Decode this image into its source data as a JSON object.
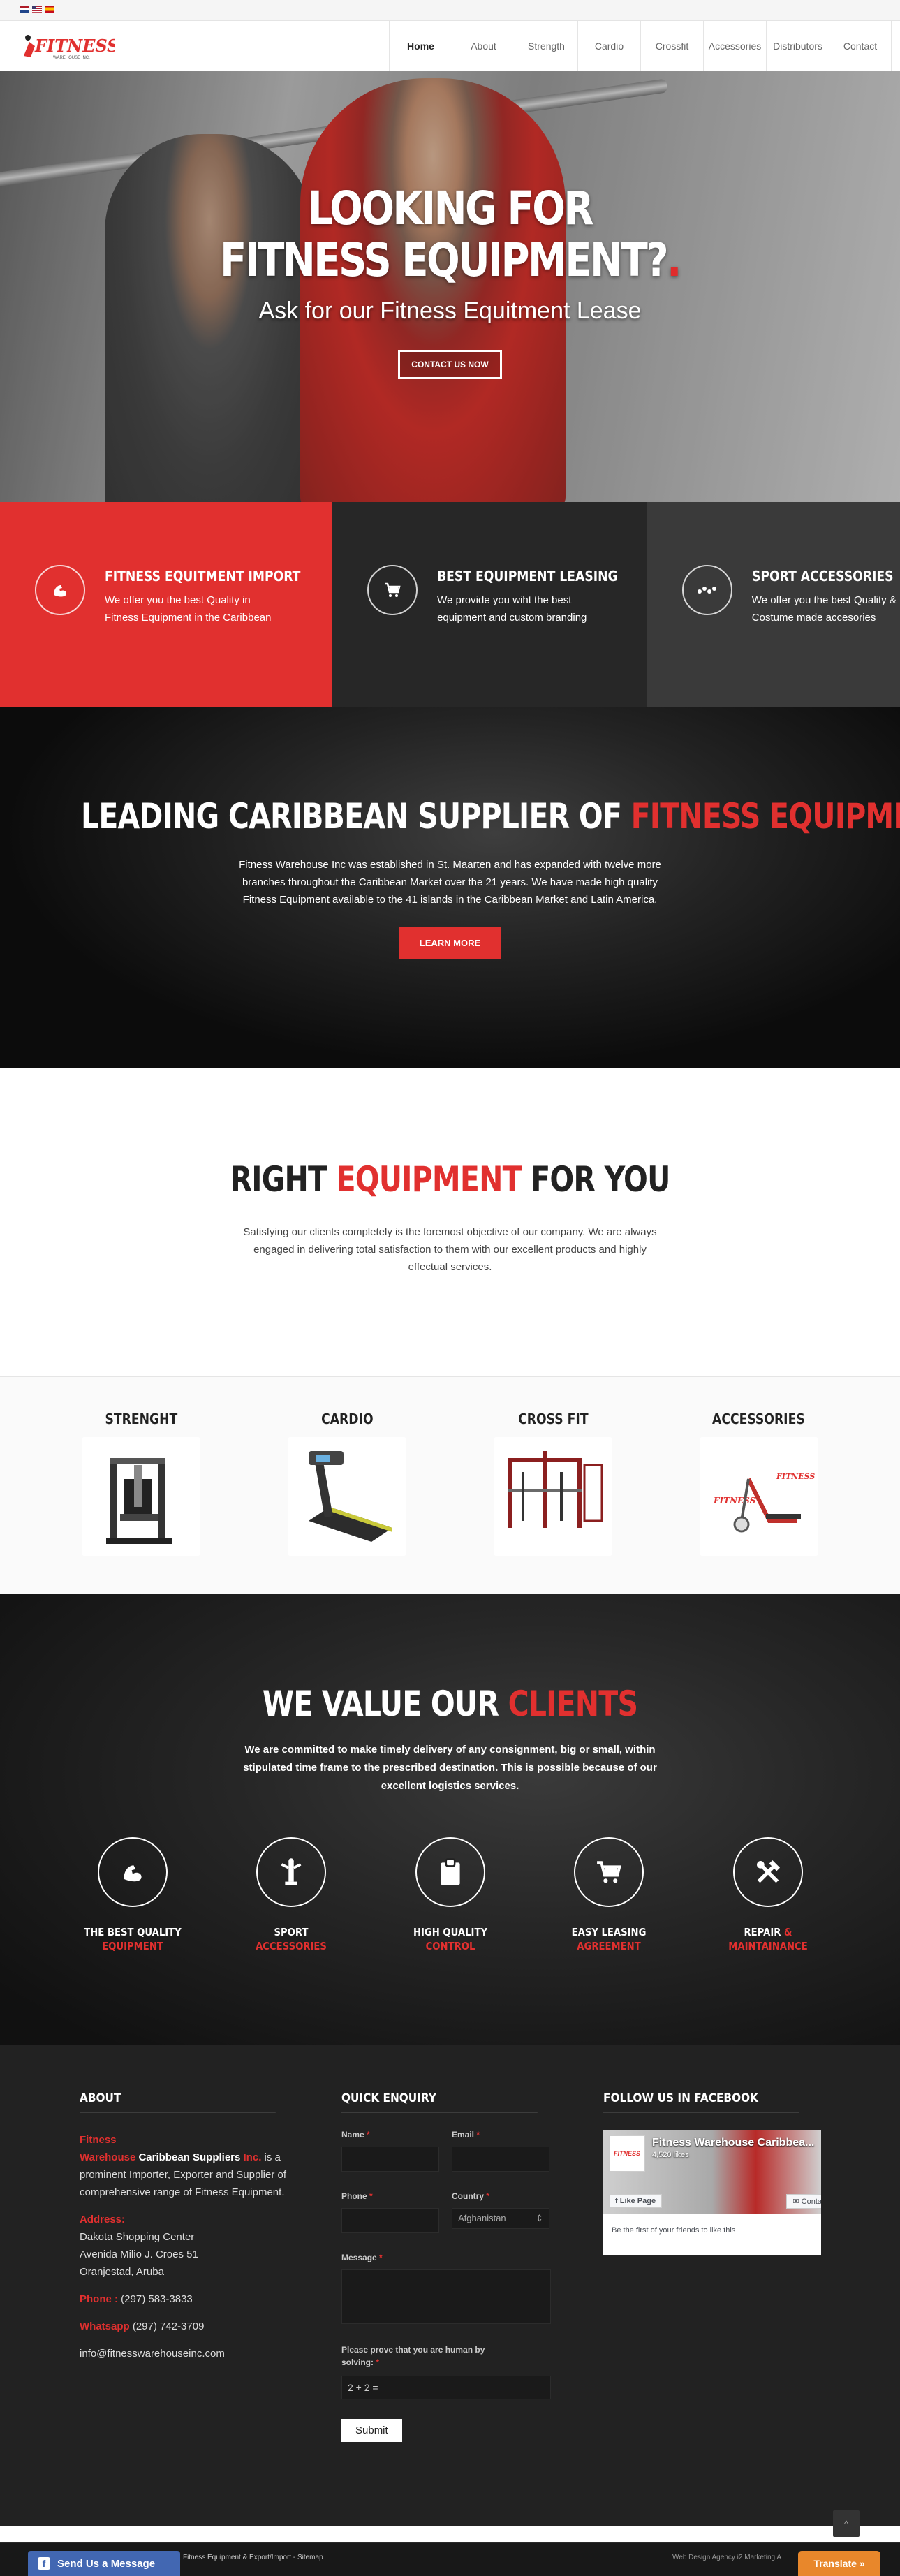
{
  "nav": {
    "logo_text": "FITNESS",
    "logo_sub": "WAREHOUSE INC.",
    "items": [
      {
        "label": "Home"
      },
      {
        "label": "About"
      },
      {
        "label": "Strength"
      },
      {
        "label": "Cardio"
      },
      {
        "label": "Crossfit"
      },
      {
        "label": "Accessories"
      },
      {
        "label": "Distributors"
      },
      {
        "label": "Contact"
      }
    ]
  },
  "hero": {
    "title_line1": "LOOKING FOR",
    "title_line2": "FITNESS EQUIPMENT?",
    "title_dot": ".",
    "subtitle": "Ask for our Fitness Equitment Lease",
    "button": "CONTACT US NOW"
  },
  "features": [
    {
      "icon": "flexed-arm-icon",
      "title": "FITNESS EQUITMENT IMPORT",
      "text": "We offer you the best Quality in Fitness Equipment in the Caribbean"
    },
    {
      "icon": "cart-icon",
      "title": "BEST EQUIPMENT LEASING",
      "text": "We provide you wiht the best equipment and custom branding"
    },
    {
      "icon": "dots-icon",
      "title": "SPORT ACCESSORIES",
      "text": "We offer you the best Quality & Costume made accesories"
    }
  ],
  "leading": {
    "title_white": "LEADING CARIBBEAN SUPPLIER OF",
    "title_red": "FITNESS EQUIPMENT",
    "text": "Fitness Warehouse Inc was established in St. Maarten and has expanded with twelve more branches throughout the Caribbean Market over the 21 years. We have made high quality Fitness Equipment available to the 41 islands in the Caribbean Market and Latin America.",
    "button": "LEARN MORE"
  },
  "right_equipment": {
    "title_a": "RIGHT",
    "title_red": "EQUIPMENT",
    "title_b": "FOR YOU",
    "text": "Satisfying our clients completely is the foremost objective of our company. We are always engaged in delivering total satisfaction to them with our excellent products and highly effectual services."
  },
  "categories": [
    {
      "label": "STRENGHT"
    },
    {
      "label": "CARDIO"
    },
    {
      "label": "CROSS FIT"
    },
    {
      "label": "ACCESSORIES"
    }
  ],
  "values": {
    "title_white": "WE VALUE OUR",
    "title_red": "CLIENTS",
    "text": "We are committed to make timely delivery of any consignment, big or small, within stipulated time frame to the prescribed destination. This is possible because of our excellent logistics services.",
    "items": [
      {
        "icon": "flexed-arm-icon",
        "white": "THE BEST QUALITY",
        "red": "EQUIPMENT"
      },
      {
        "icon": "trophy-icon",
        "white": "SPORT",
        "red": "ACCESSORIES"
      },
      {
        "icon": "clipboard-icon",
        "white": "HIGH QUALITY",
        "red": "CONTROL"
      },
      {
        "icon": "cart-icon",
        "white": "EASY LEASING",
        "red": "AGREEMENT"
      },
      {
        "icon": "tools-icon",
        "white": "REPAIR",
        "red": "& MAINTAINANCE"
      }
    ]
  },
  "footer": {
    "about": {
      "title": "ABOUT",
      "red_a": "Fitness",
      "red_b": "Warehouse",
      "bold": "Caribbean Suppliers",
      "red_c": "Inc.",
      "rest": "is a prominent Importer, Exporter and Supplier of comprehensive range of Fitness Equipment.",
      "address_label": "Address:",
      "address_1": "Dakota Shopping Center",
      "address_2": "Avenida Milio J. Croes 51",
      "address_3": "Oranjestad, Aruba",
      "phone_label": "Phone :",
      "phone": "(297) 583-3833",
      "whatsapp_label": "Whatsapp",
      "whatsapp": "(297) 742-3709",
      "email": "info@fitnesswarehouseinc.com"
    },
    "enquiry": {
      "title": "QUICK ENQUIRY",
      "name": "Name",
      "email": "Email",
      "phone": "Phone",
      "country": "Country",
      "country_value": "Afghanistan",
      "message": "Message",
      "captcha_label": "Please prove that you are human by solving:",
      "captcha_value": "2 + 2 =",
      "submit": "Submit",
      "required": "*"
    },
    "facebook": {
      "title": "FOLLOW US IN FACEBOOK",
      "page_name": "Fitness Warehouse Caribbea...",
      "likes": "4,520 likes",
      "like_button": "Like Page",
      "contact_button": "Conta",
      "friends": "Be the first of your friends to like this",
      "logo_text": "FITNESS"
    }
  },
  "bottom": {
    "links": "Fitness Equipment  &  Export/Import - Sitemap",
    "right": "Web Design Agency   i2 Marketing A",
    "send_message": "Send Us a Message",
    "translate": "Translate »",
    "scroll_top": "^"
  },
  "colors": {
    "accent_red": "#e1302f",
    "dark": "#222222",
    "facebook_blue": "#4267b2",
    "translate_orange": "#e8872b"
  }
}
